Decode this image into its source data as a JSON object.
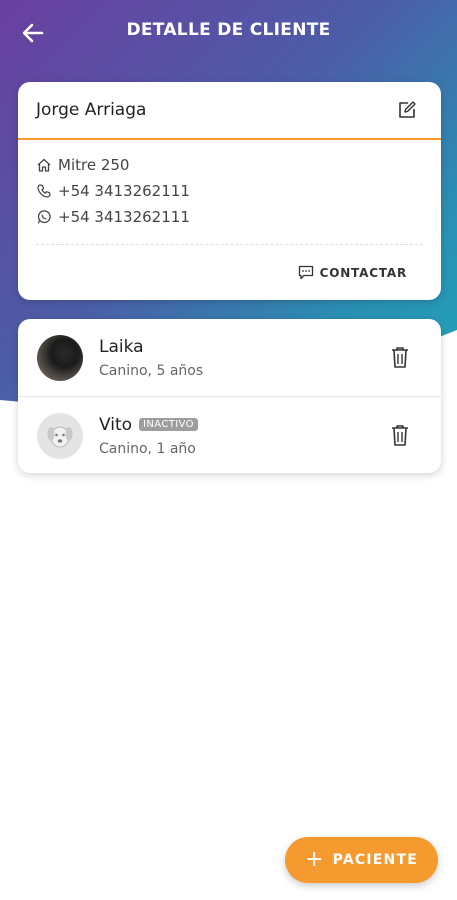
{
  "app_bar": {
    "title": "DETALLE DE CLIENTE"
  },
  "client": {
    "name": "Jorge Arriaga",
    "address": "Mitre 250",
    "phone": "+54 3413262111",
    "whatsapp": "+54 3413262111",
    "contact_label": "CONTACTAR"
  },
  "patients": [
    {
      "name": "Laika",
      "details": "Canino, 5 años",
      "badge": ""
    },
    {
      "name": "Vito",
      "details": "Canino, 1 año",
      "badge": "INACTIVO"
    }
  ],
  "fab": {
    "label": "PACIENTE"
  },
  "colors": {
    "accent": "#f59a2e",
    "header_gradient_start": "#6a3fa0",
    "header_gradient_end": "#20a6b8",
    "badge": "#9e9e9e"
  },
  "icons": {
    "back": "arrow-left-icon",
    "edit": "edit-icon",
    "address": "home-icon",
    "phone": "phone-icon",
    "whatsapp": "whatsapp-icon",
    "contact": "chat-icon",
    "delete": "trash-icon",
    "add": "plus-icon"
  }
}
